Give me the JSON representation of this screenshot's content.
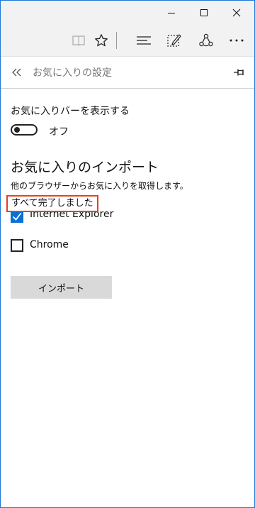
{
  "window": {
    "controls": {
      "minimize": "minimize-icon",
      "maximize": "maximize-icon",
      "close": "close-icon"
    }
  },
  "toolbar": {
    "icons": [
      "reading-view-icon",
      "favorite-star-icon",
      "hub-icon",
      "web-note-icon",
      "share-icon",
      "more-icon"
    ]
  },
  "pane": {
    "title": "お気に入りの設定"
  },
  "favorites_bar": {
    "label": "お気に入りバーを表示する",
    "toggle_state": "オフ",
    "toggle_on": false
  },
  "import": {
    "heading": "お気に入りのインポート",
    "description": "他のブラウザーからお気に入りを取得します。",
    "status": "すべて完了しました",
    "browsers": [
      {
        "label": "Internet Explorer",
        "checked": true
      },
      {
        "label": "Chrome",
        "checked": false
      }
    ],
    "button_label": "インポート"
  },
  "colors": {
    "accent": "#0a6fd6",
    "highlight_border": "#e8401c",
    "button_bg": "#d9d9d9"
  }
}
